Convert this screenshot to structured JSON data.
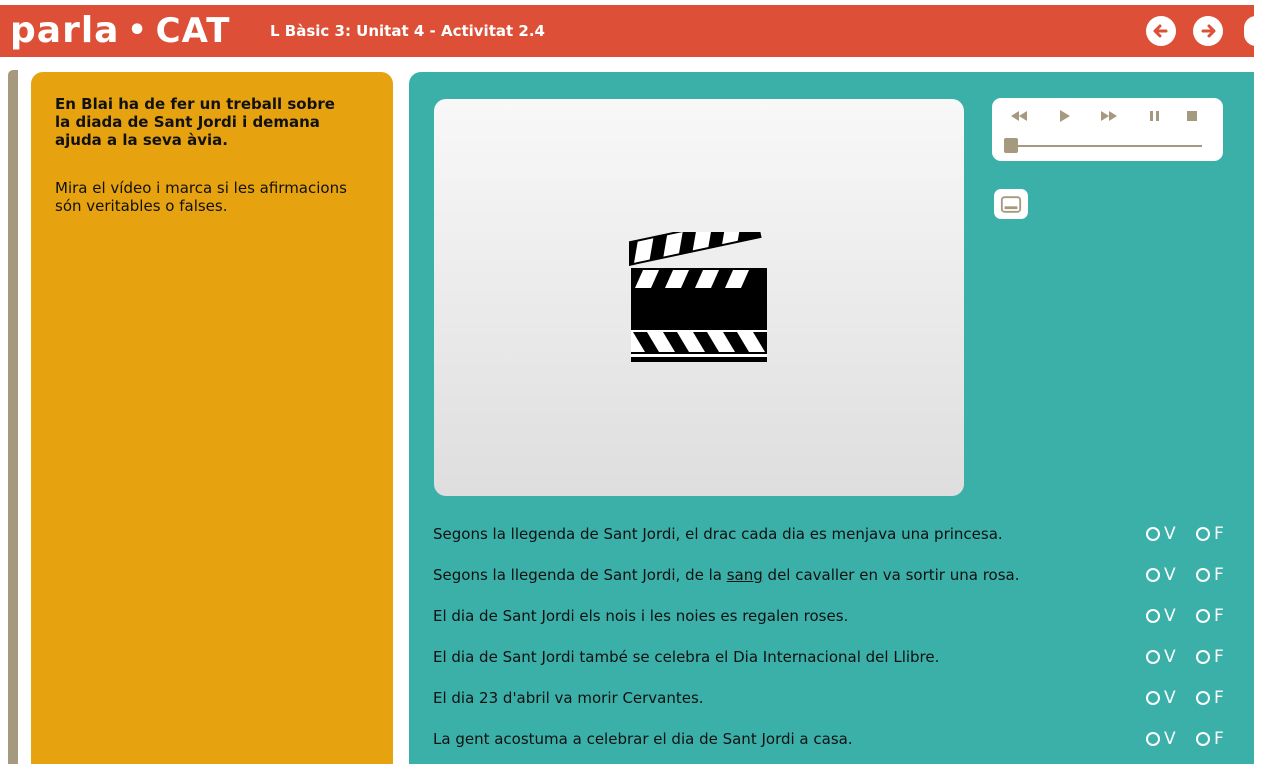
{
  "header": {
    "logo_text": "parla",
    "logo_dot": "•",
    "logo_cat": "CAT",
    "title": "L Bàsic 3: Unitat 4 - Activitat 2.4",
    "prev_label": "previous",
    "next_label": "next"
  },
  "instructions": {
    "lead": "En Blai ha de fer un treball sobre la diada de Sant Jordi i demana ajuda a la seva àvia.",
    "sub": "Mira el vídeo i marca si les afirmacions són veritables o falses."
  },
  "colors": {
    "header": "#dd4f37",
    "instruction_panel": "#e6a20f",
    "activity_panel": "#3ab0a9",
    "strip": "#a5997f"
  },
  "player": {
    "progress": 0
  },
  "options": {
    "true_label": "V",
    "false_label": "F"
  },
  "questions": [
    {
      "before": "Segons la llegenda de Sant Jordi, el drac cada dia es menjava una princesa.",
      "u": "",
      "after": ""
    },
    {
      "before": "Segons la llegenda de Sant Jordi, de la ",
      "u": "sang",
      "after": " del cavaller en va sortir una rosa."
    },
    {
      "before": "El dia de Sant Jordi els nois i les noies es regalen roses.",
      "u": "",
      "after": ""
    },
    {
      "before": "El dia de Sant Jordi també se celebra el Dia Internacional del Llibre.",
      "u": "",
      "after": ""
    },
    {
      "before": "El dia 23 d'abril va morir Cervantes.",
      "u": "",
      "after": ""
    },
    {
      "before": "La gent acostuma a celebrar el dia de Sant Jordi a casa.",
      "u": "",
      "after": ""
    }
  ]
}
